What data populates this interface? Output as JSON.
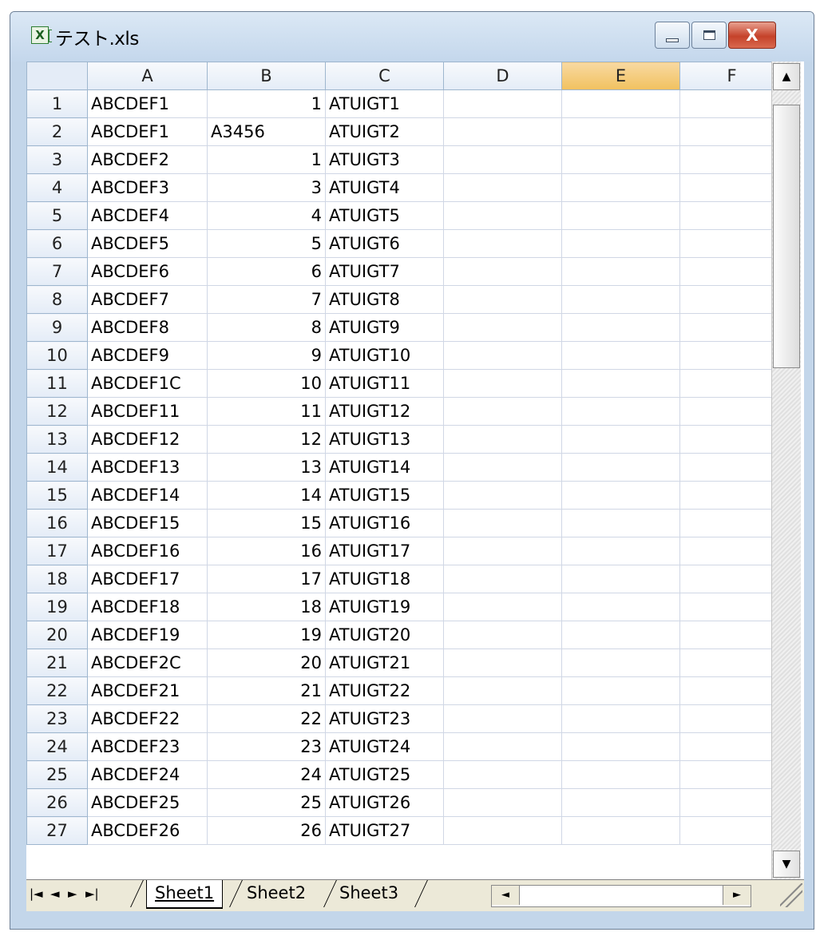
{
  "window": {
    "title": "テスト.xls",
    "minimize_label": "",
    "maximize_label": "",
    "close_label": "X"
  },
  "columns": [
    "A",
    "B",
    "C",
    "D",
    "E",
    "F"
  ],
  "selected_column": "E",
  "rows": [
    {
      "n": "1",
      "a": "ABCDEF1",
      "b": "1",
      "c": "ATUIGT1"
    },
    {
      "n": "2",
      "a": "ABCDEF1",
      "b": "A3456",
      "c": "ATUIGT2"
    },
    {
      "n": "3",
      "a": "ABCDEF2",
      "b": "1",
      "c": "ATUIGT3"
    },
    {
      "n": "4",
      "a": "ABCDEF3",
      "b": "3",
      "c": "ATUIGT4"
    },
    {
      "n": "5",
      "a": "ABCDEF4",
      "b": "4",
      "c": "ATUIGT5"
    },
    {
      "n": "6",
      "a": "ABCDEF5",
      "b": "5",
      "c": "ATUIGT6"
    },
    {
      "n": "7",
      "a": "ABCDEF6",
      "b": "6",
      "c": "ATUIGT7"
    },
    {
      "n": "8",
      "a": "ABCDEF7",
      "b": "7",
      "c": "ATUIGT8"
    },
    {
      "n": "9",
      "a": "ABCDEF8",
      "b": "8",
      "c": "ATUIGT9"
    },
    {
      "n": "10",
      "a": "ABCDEF9",
      "b": "9",
      "c": "ATUIGT10"
    },
    {
      "n": "11",
      "a": "ABCDEF1C",
      "b": "10",
      "c": "ATUIGT11"
    },
    {
      "n": "12",
      "a": "ABCDEF11",
      "b": "11",
      "c": "ATUIGT12"
    },
    {
      "n": "13",
      "a": "ABCDEF12",
      "b": "12",
      "c": "ATUIGT13"
    },
    {
      "n": "14",
      "a": "ABCDEF13",
      "b": "13",
      "c": "ATUIGT14"
    },
    {
      "n": "15",
      "a": "ABCDEF14",
      "b": "14",
      "c": "ATUIGT15"
    },
    {
      "n": "16",
      "a": "ABCDEF15",
      "b": "15",
      "c": "ATUIGT16"
    },
    {
      "n": "17",
      "a": "ABCDEF16",
      "b": "16",
      "c": "ATUIGT17"
    },
    {
      "n": "18",
      "a": "ABCDEF17",
      "b": "17",
      "c": "ATUIGT18"
    },
    {
      "n": "19",
      "a": "ABCDEF18",
      "b": "18",
      "c": "ATUIGT19"
    },
    {
      "n": "20",
      "a": "ABCDEF19",
      "b": "19",
      "c": "ATUIGT20"
    },
    {
      "n": "21",
      "a": "ABCDEF2C",
      "b": "20",
      "c": "ATUIGT21"
    },
    {
      "n": "22",
      "a": "ABCDEF21",
      "b": "21",
      "c": "ATUIGT22"
    },
    {
      "n": "23",
      "a": "ABCDEF22",
      "b": "22",
      "c": "ATUIGT23"
    },
    {
      "n": "24",
      "a": "ABCDEF23",
      "b": "23",
      "c": "ATUIGT24"
    },
    {
      "n": "25",
      "a": "ABCDEF24",
      "b": "24",
      "c": "ATUIGT25"
    },
    {
      "n": "26",
      "a": "ABCDEF25",
      "b": "25",
      "c": "ATUIGT26"
    },
    {
      "n": "27",
      "a": "ABCDEF26",
      "b": "26",
      "c": "ATUIGT27"
    }
  ],
  "tabs": [
    "Sheet1",
    "Sheet2",
    "Sheet3"
  ],
  "active_tab": "Sheet1",
  "icons": {
    "nav_first": "|◄",
    "nav_prev": "◄",
    "nav_next": "►",
    "nav_last": "►|",
    "scroll_up": "▲",
    "scroll_down": "▼",
    "scroll_left": "◄",
    "scroll_right": "►",
    "app": "X"
  },
  "colors": {
    "selected_header": "#f1c15f",
    "gridline": "#d0d7e5",
    "close_button": "#c5422a"
  }
}
